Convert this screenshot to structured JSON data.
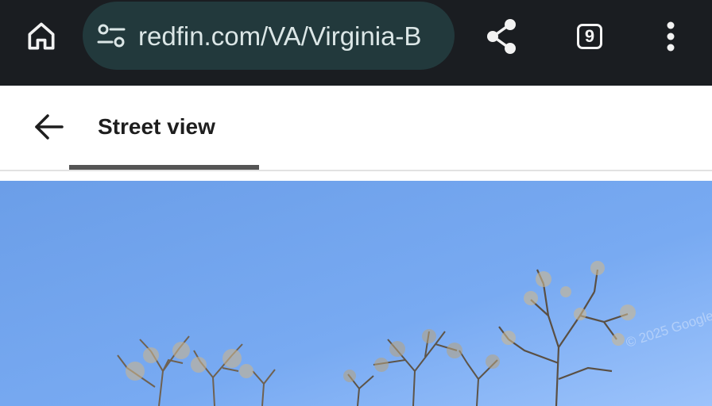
{
  "browser": {
    "url": "redfin.com/VA/Virginia-B",
    "tab_count": "9",
    "bar_color": "#1a1d21",
    "pill_color": "#22393c",
    "icons": {
      "home": "home-icon",
      "site_settings": "tune-icon",
      "share": "share-icon",
      "tabs": "tabs-icon",
      "menu": "more-vert-icon"
    }
  },
  "header": {
    "back_icon": "arrow-left-icon",
    "tabs": [
      {
        "label": "Street view",
        "selected": true
      }
    ],
    "indicator_color": "#555555"
  },
  "street_view": {
    "watermark": "© 2025 Google",
    "sky_color": "#7aa9f0"
  }
}
